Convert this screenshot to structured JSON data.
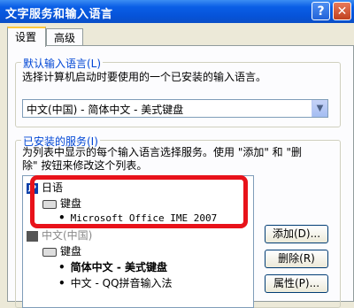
{
  "window": {
    "title": "文字服务和输入语言",
    "help_glyph": "?",
    "close_glyph": "✕"
  },
  "tabs": [
    {
      "label": "设置"
    },
    {
      "label": "高级"
    }
  ],
  "default_lang": {
    "group_label": "默认输入语言(L)",
    "description": "选择计算机启动时要使用的一个已安装的输入语言。",
    "selected": "中文(中国) - 简体中文 - 美式键盘"
  },
  "installed": {
    "group_label": "已安装的服务(I)",
    "description_line1": "为列表中显示的每个输入语言选择服务。使用 \"添加\" 和 \"删",
    "description_line2": "除\" 按钮来修改这个列表。",
    "tree": {
      "lang1": {
        "badge": "JP",
        "name": "日语",
        "category": "键盘",
        "service": "Microsoft Office IME 2007"
      },
      "lang2": {
        "name": "中文(中国)",
        "category": "键盘",
        "service1": "简体中文 - 美式键盘",
        "service2": "中文 - QQ拼音输入法"
      }
    },
    "buttons": {
      "add": "添加(D)...",
      "remove": "删除(R)",
      "properties": "属性(P)..."
    }
  },
  "colors": {
    "highlight": "#e8121a",
    "titlebar": "#0653d9"
  }
}
